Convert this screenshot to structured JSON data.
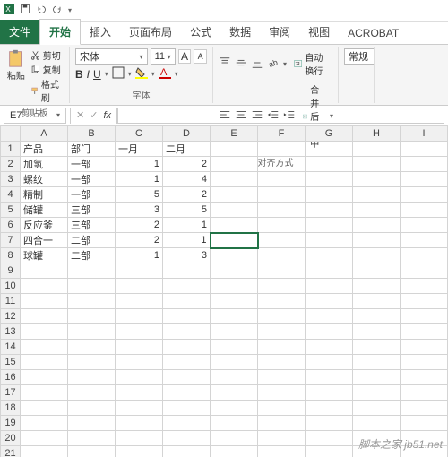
{
  "qat": {
    "save": "save",
    "undo": "undo",
    "redo": "redo"
  },
  "tabs": {
    "file": "文件",
    "home": "开始",
    "insert": "插入",
    "layout": "页面布局",
    "formulas": "公式",
    "data": "数据",
    "review": "审阅",
    "view": "视图",
    "acrobat": "ACROBAT"
  },
  "ribbon": {
    "clipboard": {
      "paste": "粘贴",
      "cut": "剪切",
      "copy": "复制",
      "format_painter": "格式刷",
      "group": "剪贴板"
    },
    "font": {
      "name": "宋体",
      "size": "11",
      "increase": "A",
      "decrease": "A",
      "bold": "B",
      "italic": "I",
      "underline": "U",
      "group": "字体"
    },
    "alignment": {
      "wrap": "自动换行",
      "merge": "合并后居中",
      "group": "对齐方式"
    },
    "number": {
      "general": "常规"
    }
  },
  "namebox": {
    "ref": "E7",
    "fx": "fx"
  },
  "columns": [
    "A",
    "B",
    "C",
    "D",
    "E",
    "F",
    "G",
    "H",
    "I"
  ],
  "rows": [
    {
      "n": 1,
      "c": [
        "产品",
        "部门",
        "一月",
        "二月",
        "",
        "",
        "",
        "",
        ""
      ]
    },
    {
      "n": 2,
      "c": [
        "加氢",
        "一部",
        "1",
        "2",
        "",
        "",
        "",
        "",
        ""
      ]
    },
    {
      "n": 3,
      "c": [
        "螺纹",
        "一部",
        "1",
        "4",
        "",
        "",
        "",
        "",
        ""
      ]
    },
    {
      "n": 4,
      "c": [
        "精制",
        "一部",
        "5",
        "2",
        "",
        "",
        "",
        "",
        ""
      ]
    },
    {
      "n": 5,
      "c": [
        "储罐",
        "三部",
        "3",
        "5",
        "",
        "",
        "",
        "",
        ""
      ]
    },
    {
      "n": 6,
      "c": [
        "反应釜",
        "三部",
        "2",
        "1",
        "",
        "",
        "",
        "",
        ""
      ]
    },
    {
      "n": 7,
      "c": [
        "四合一",
        "二部",
        "2",
        "1",
        "",
        "",
        "",
        "",
        ""
      ]
    },
    {
      "n": 8,
      "c": [
        "球罐",
        "二部",
        "1",
        "3",
        "",
        "",
        "",
        "",
        ""
      ]
    },
    {
      "n": 9,
      "c": [
        "",
        "",
        "",
        "",
        "",
        "",
        "",
        "",
        ""
      ]
    },
    {
      "n": 10,
      "c": [
        "",
        "",
        "",
        "",
        "",
        "",
        "",
        "",
        ""
      ]
    },
    {
      "n": 11,
      "c": [
        "",
        "",
        "",
        "",
        "",
        "",
        "",
        "",
        ""
      ]
    },
    {
      "n": 12,
      "c": [
        "",
        "",
        "",
        "",
        "",
        "",
        "",
        "",
        ""
      ]
    },
    {
      "n": 13,
      "c": [
        "",
        "",
        "",
        "",
        "",
        "",
        "",
        "",
        ""
      ]
    },
    {
      "n": 14,
      "c": [
        "",
        "",
        "",
        "",
        "",
        "",
        "",
        "",
        ""
      ]
    },
    {
      "n": 15,
      "c": [
        "",
        "",
        "",
        "",
        "",
        "",
        "",
        "",
        ""
      ]
    },
    {
      "n": 16,
      "c": [
        "",
        "",
        "",
        "",
        "",
        "",
        "",
        "",
        ""
      ]
    },
    {
      "n": 17,
      "c": [
        "",
        "",
        "",
        "",
        "",
        "",
        "",
        "",
        ""
      ]
    },
    {
      "n": 18,
      "c": [
        "",
        "",
        "",
        "",
        "",
        "",
        "",
        "",
        ""
      ]
    },
    {
      "n": 19,
      "c": [
        "",
        "",
        "",
        "",
        "",
        "",
        "",
        "",
        ""
      ]
    },
    {
      "n": 20,
      "c": [
        "",
        "",
        "",
        "",
        "",
        "",
        "",
        "",
        ""
      ]
    },
    {
      "n": 21,
      "c": [
        "",
        "",
        "",
        "",
        "",
        "",
        "",
        "",
        ""
      ]
    }
  ],
  "selected": {
    "row": 7,
    "col": 4
  },
  "watermark": "脚本之家\njb51.net"
}
